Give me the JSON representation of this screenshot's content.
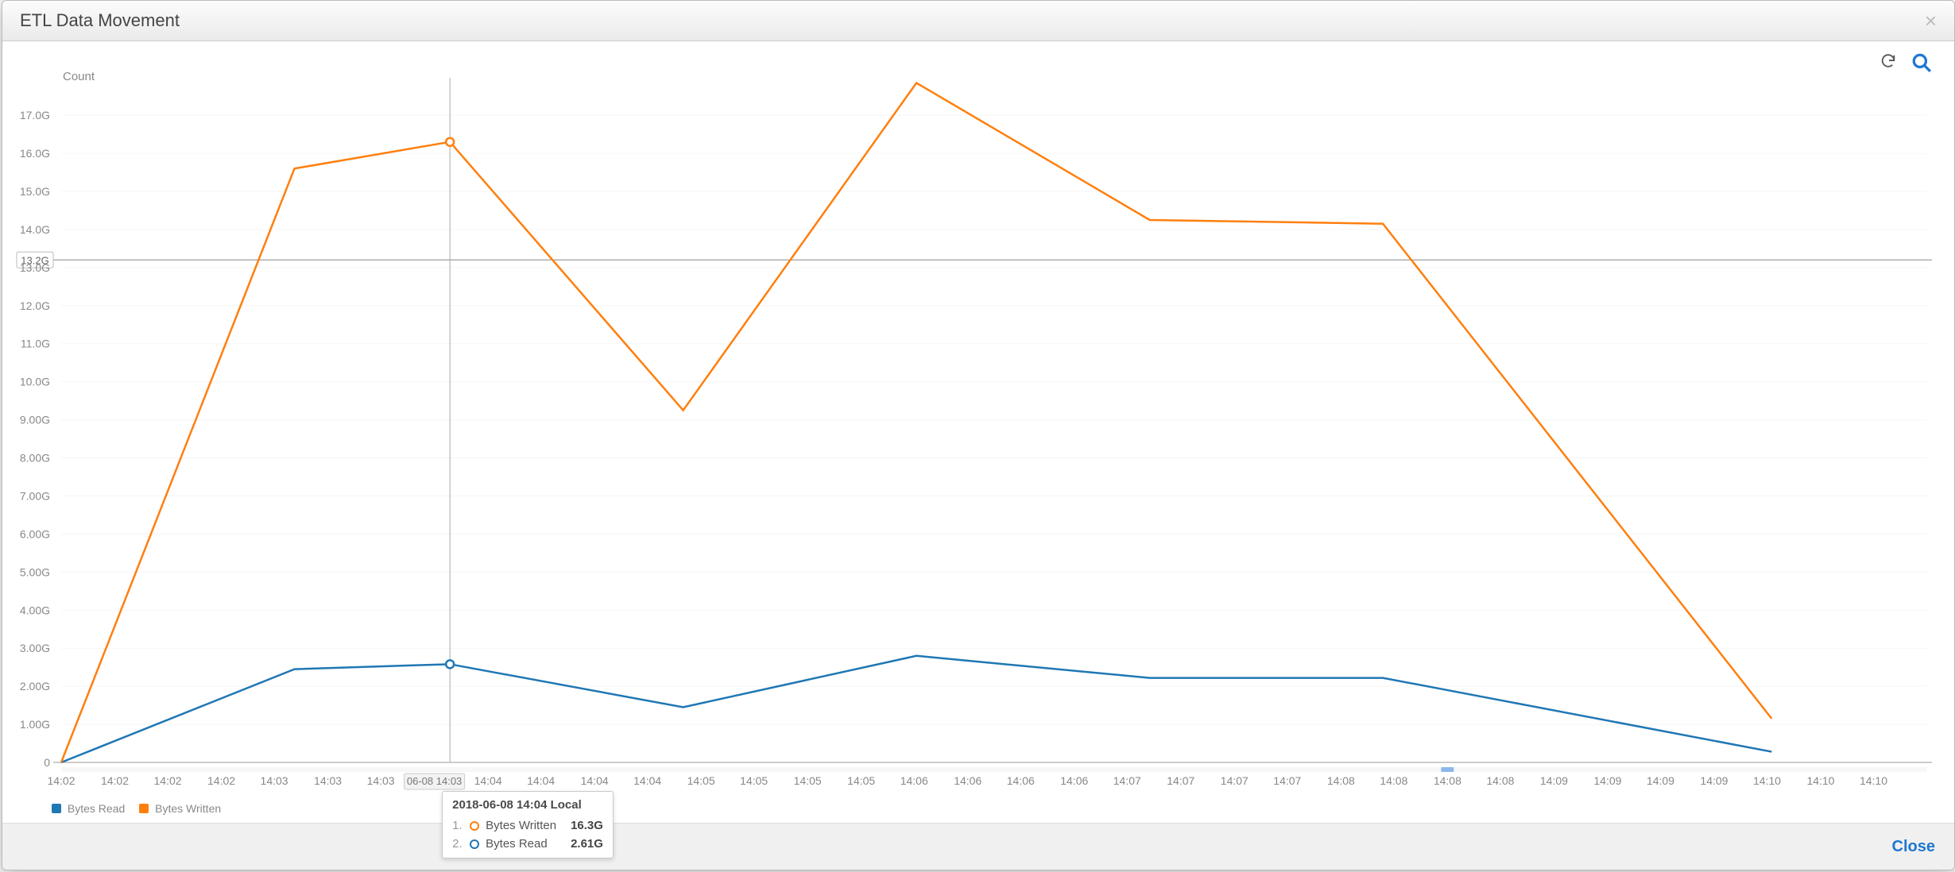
{
  "modal": {
    "title": "ETL Data Movement",
    "close_label": "Close"
  },
  "toolbar": {
    "refresh_name": "refresh-icon",
    "zoom_name": "zoom-icon"
  },
  "legend": {
    "items": [
      {
        "name": "Bytes Read",
        "color": "#1f77b4"
      },
      {
        "name": "Bytes Written",
        "color": "#ff7f0e"
      }
    ]
  },
  "colors": {
    "bytes_read": "#1f77b4",
    "bytes_written": "#ff7f0e",
    "zoom_icon": "#1f77d0"
  },
  "tooltip": {
    "title": "2018-06-08 14:04 Local",
    "rows": [
      {
        "idx": "1.",
        "color": "#ff7f0e",
        "name": "Bytes Written",
        "value": "16.3G"
      },
      {
        "idx": "2.",
        "color": "#1f77b4",
        "name": "Bytes Read",
        "value": "2.61G"
      }
    ]
  },
  "chart_data": {
    "type": "line",
    "title": "ETL Data Movement",
    "ylabel": "Count",
    "xlabel": "",
    "ylim": [
      0,
      17.9
    ],
    "y_unit": "G",
    "y_ticks": [
      0,
      1,
      2,
      3,
      4,
      5,
      6,
      7,
      8,
      9,
      10,
      11,
      12,
      13,
      14,
      15,
      16,
      17
    ],
    "y_tick_labels": [
      "0",
      "1.00G",
      "2.00G",
      "3.00G",
      "4.00G",
      "5.00G",
      "6.00G",
      "7.00G",
      "8.00G",
      "9.00G",
      "10.0G",
      "11.0G",
      "12.0G",
      "13.0G",
      "14.0G",
      "15.0G",
      "16.0G",
      "17.0G"
    ],
    "ref_line": {
      "value": 13.2,
      "label": "13.2G"
    },
    "x_domain": [
      0,
      24
    ],
    "x_categories_draw": [
      "14:02",
      "14:02",
      "14:02",
      "14:02",
      "14:03",
      "14:03",
      "14:03",
      "06-08 14:03",
      "14:04",
      "14:04",
      "14:04",
      "14:04",
      "14:05",
      "14:05",
      "14:05",
      "14:05",
      "14:06",
      "14:06",
      "14:06",
      "14:06",
      "14:07",
      "14:07",
      "14:07",
      "14:07",
      "14:08",
      "14:08",
      "14:08",
      "14:08",
      "14:09",
      "14:09",
      "14:09",
      "14:09",
      "14:10",
      "14:10",
      "14:10"
    ],
    "x_badged_index": 7,
    "hover_index_draw": 8,
    "x_drawn": [
      0,
      0.69,
      1.37,
      2.06,
      2.74,
      3.43,
      4.11,
      4.8,
      5.49,
      6.17,
      6.86,
      7.54,
      8.23,
      8.91,
      9.6,
      10.29,
      10.97,
      11.66,
      12.34,
      13.03,
      13.71,
      14.4,
      15.09,
      15.77,
      16.46,
      17.14,
      17.83,
      18.51,
      19.2,
      19.89,
      20.57,
      21.26,
      21.94,
      22.63,
      23.31,
      24.0
    ],
    "range_selection_index": 26,
    "series": [
      {
        "name": "Bytes Read",
        "color": "#1f77b4",
        "points": [
          {
            "x": 0,
            "y": 0.0
          },
          {
            "x": 3,
            "y": 2.45
          },
          {
            "x": 5,
            "y": 2.58
          },
          {
            "x": 8,
            "y": 1.45
          },
          {
            "x": 11,
            "y": 2.8
          },
          {
            "x": 14,
            "y": 2.22
          },
          {
            "x": 17,
            "y": 2.22
          },
          {
            "x": 22,
            "y": 0.28
          }
        ]
      },
      {
        "name": "Bytes Written",
        "color": "#ff7f0e",
        "points": [
          {
            "x": 0,
            "y": 0.0
          },
          {
            "x": 3,
            "y": 15.6
          },
          {
            "x": 5,
            "y": 16.3
          },
          {
            "x": 8,
            "y": 9.25
          },
          {
            "x": 11,
            "y": 17.85
          },
          {
            "x": 14,
            "y": 14.25
          },
          {
            "x": 17,
            "y": 14.15
          },
          {
            "x": 22,
            "y": 1.15
          }
        ]
      }
    ],
    "hover_values": {
      "Bytes Read": 2.61,
      "Bytes Written": 16.3
    }
  }
}
